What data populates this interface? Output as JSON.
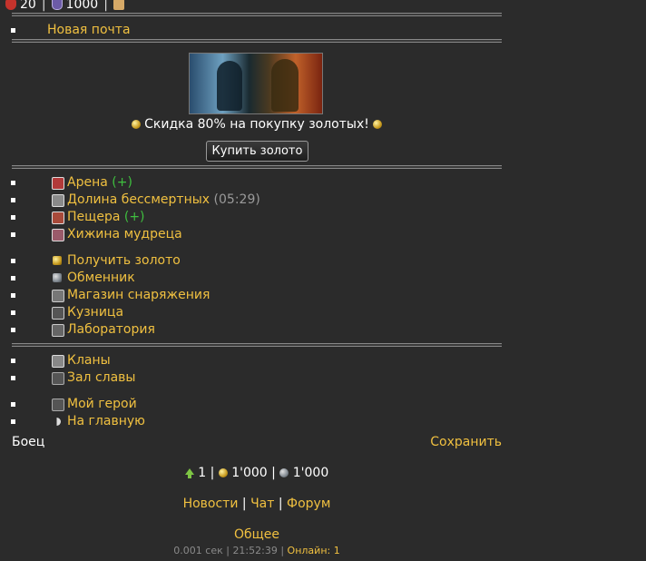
{
  "topbar": {
    "health": "20",
    "shield": "1000"
  },
  "mail": {
    "label": "Новая почта"
  },
  "promo": {
    "text": "Скидка 80% на покупку золотых!",
    "button": "Купить золото"
  },
  "menu1": [
    {
      "label": "Арена",
      "extra": "(+)",
      "extra_color": "#3fbf3f",
      "icon": "arena-icon"
    },
    {
      "label": "Долина бессмертных",
      "extra": "(05:29)",
      "extra_color": "#9a9a9a",
      "icon": "valley-icon"
    },
    {
      "label": "Пещера",
      "extra": "(+)",
      "extra_color": "#3fbf3f",
      "icon": "cave-icon"
    },
    {
      "label": "Хижина мудреца",
      "extra": "",
      "icon": "hut-icon"
    }
  ],
  "menu2": [
    {
      "label": "Получить золото",
      "icon": "gold-coin-icon"
    },
    {
      "label": "Обменник",
      "icon": "exchange-icon"
    },
    {
      "label": "Магазин снаряжения",
      "icon": "shop-icon"
    },
    {
      "label": "Кузница",
      "icon": "forge-icon"
    },
    {
      "label": "Лаборатория",
      "icon": "lab-icon"
    }
  ],
  "menu3": [
    {
      "label": "Кланы",
      "icon": "clans-icon"
    },
    {
      "label": "Зал славы",
      "icon": "hall-of-fame-icon"
    }
  ],
  "menu4": [
    {
      "label": "Мой герой",
      "icon": "hero-icon"
    },
    {
      "label": "На главную",
      "icon": "home-icon"
    }
  ],
  "profile": {
    "left": "Боец",
    "right": "Сохранить"
  },
  "stats": {
    "level": "1",
    "gold": "1'000",
    "silver": "1'000"
  },
  "links": {
    "news": "Новости",
    "chat": "Чат",
    "forum": "Форум"
  },
  "general": "Общее",
  "footer": {
    "time": "0.001 сек",
    "clock": "21:52:39",
    "online": "Онлайн: 1"
  },
  "colors": {
    "background": "#2b2b2b",
    "link": "#f0c040",
    "green": "#3fbf3f"
  }
}
